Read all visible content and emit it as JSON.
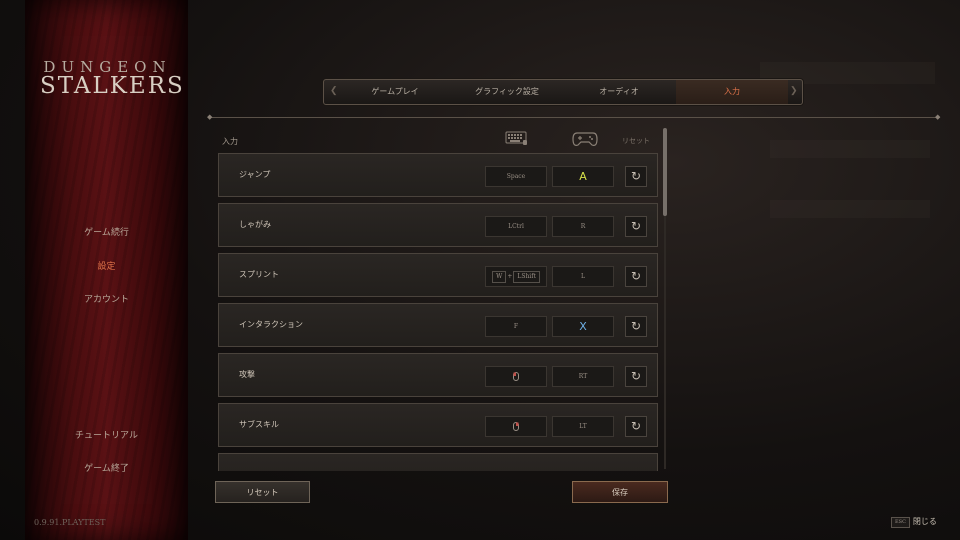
{
  "logo": {
    "top": "DUNGEON",
    "bottom": "STALKERS"
  },
  "sidebar": {
    "items": [
      {
        "label": "ゲーム続行"
      },
      {
        "label": "設定"
      },
      {
        "label": "アカウント"
      },
      {
        "label": "チュートリアル"
      },
      {
        "label": "ゲーム終了"
      }
    ],
    "active": "設定"
  },
  "version": "0.9.91.PLAYTEST",
  "tabs": [
    {
      "label": "ゲームプレイ"
    },
    {
      "label": "グラフィック設定"
    },
    {
      "label": "オーディオ"
    },
    {
      "label": "入力"
    }
  ],
  "active_tab": "入力",
  "header": {
    "label": "入力",
    "reset": "リセット",
    "keyboard_icon": "keyboard-icon",
    "gamepad_icon": "gamepad-icon"
  },
  "rows": [
    {
      "label": "ジャンプ",
      "keyboard": "Space",
      "pad": "A",
      "pad_color": "#d7e24a"
    },
    {
      "label": "しゃがみ",
      "keyboard": "LCtrl",
      "pad": "R",
      "pad_color": "#9a9086"
    },
    {
      "label": "スプリント",
      "keyboard_parts": [
        "W",
        "+",
        "LShift"
      ],
      "pad": "L",
      "pad_color": "#9a9086"
    },
    {
      "label": "インタラクション",
      "keyboard": "F",
      "pad": "X",
      "pad_color": "#6fb0e6"
    },
    {
      "label": "攻撃",
      "keyboard_icon": "mouse-left-icon",
      "pad": "RT",
      "pad_color": "#9a9086"
    },
    {
      "label": "サブスキル",
      "keyboard_icon": "mouse-right-icon",
      "pad": "LT",
      "pad_color": "#9a9086"
    }
  ],
  "buttons": {
    "reset": "リセット",
    "save": "保存"
  },
  "esc": {
    "key": "ESC",
    "label": "閉じる"
  },
  "colors": {
    "accent": "#e0744a",
    "sidebar": "#5a1114"
  }
}
